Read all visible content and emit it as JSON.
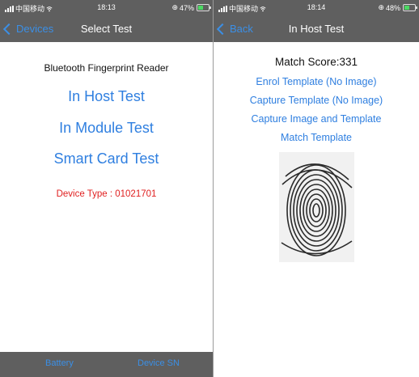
{
  "left_screen": {
    "status": {
      "carrier": "中国移动",
      "time": "18:13",
      "battery": "47%"
    },
    "nav": {
      "back_label": "Devices",
      "title": "Select Test"
    },
    "heading": "Bluetooth Fingerprint Reader",
    "buttons": {
      "in_host": "In Host Test",
      "in_module": "In Module Test",
      "smart_card": "Smart Card Test"
    },
    "device_type": "Device Type : 01021701",
    "tabbar": {
      "battery": "Battery",
      "device_sn": "Device SN"
    }
  },
  "right_screen": {
    "status": {
      "carrier": "中国移动",
      "time": "18:14",
      "battery": "48%"
    },
    "nav": {
      "back_label": "Back",
      "title": "In Host Test"
    },
    "match_score": "Match Score:331",
    "actions": {
      "enrol": "Enrol Template (No Image)",
      "capture_template": "Capture Template (No Image)",
      "capture_image": "Capture Image and Template",
      "match": "Match Template"
    }
  },
  "colors": {
    "bar": "#5f5f5f",
    "link": "#2f7fe0",
    "alert": "#e02020",
    "battery_charging": "#4cd964"
  },
  "icons": [
    "back-chevron-icon",
    "signal-icon",
    "wifi-icon",
    "battery-icon",
    "fingerprint-image"
  ]
}
